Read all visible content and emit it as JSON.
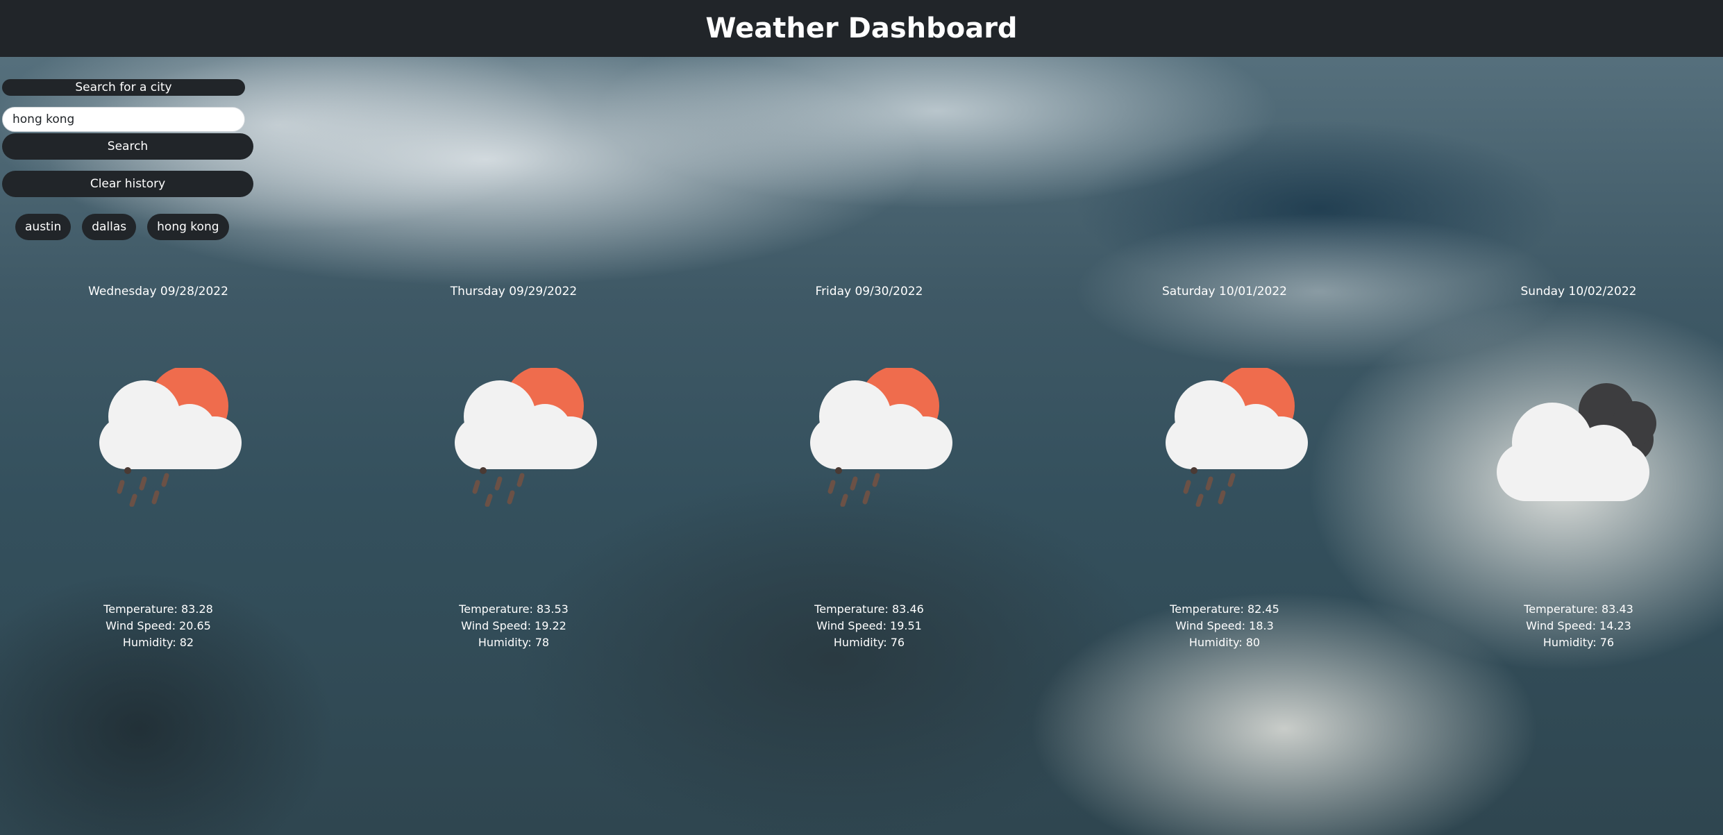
{
  "header": {
    "title": "Weather Dashboard"
  },
  "search": {
    "label": "Search for a city",
    "input_value": "hong kong",
    "search_button": "Search",
    "clear_button": "Clear history"
  },
  "history": [
    "austin",
    "dallas",
    "hong kong"
  ],
  "forecast": [
    {
      "date": "Wednesday 09/28/2022",
      "icon": "rain-sun-icon",
      "temperature": "Temperature: 83.28",
      "wind": "Wind Speed: 20.65",
      "humidity": "Humidity: 82"
    },
    {
      "date": "Thursday 09/29/2022",
      "icon": "rain-sun-icon",
      "temperature": "Temperature: 83.53",
      "wind": "Wind Speed: 19.22",
      "humidity": "Humidity: 78"
    },
    {
      "date": "Friday 09/30/2022",
      "icon": "rain-sun-icon",
      "temperature": "Temperature: 83.46",
      "wind": "Wind Speed: 19.51",
      "humidity": "Humidity: 76"
    },
    {
      "date": "Saturday 10/01/2022",
      "icon": "rain-sun-icon",
      "temperature": "Temperature: 82.45",
      "wind": "Wind Speed: 18.3",
      "humidity": "Humidity: 80"
    },
    {
      "date": "Sunday 10/02/2022",
      "icon": "cloudy-icon",
      "temperature": "Temperature: 83.43",
      "wind": "Wind Speed: 14.23",
      "humidity": "Humidity: 76"
    }
  ],
  "colors": {
    "header_bg": "#212529",
    "sun": "#ef6c4d",
    "cloud": "#f2f2f2",
    "dark_cloud": "#3d3d3f",
    "rain": "#6b5146"
  }
}
